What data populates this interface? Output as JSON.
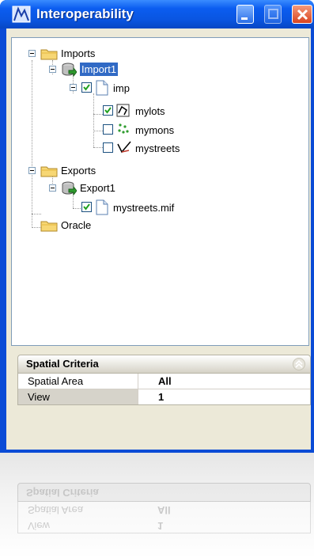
{
  "window": {
    "title": "Interoperability"
  },
  "tree": {
    "imports": "Imports",
    "import1": "Import1",
    "imp": "imp",
    "mylots": "mylots",
    "mymons": "mymons",
    "mystreets": "mystreets",
    "exports": "Exports",
    "export1": "Export1",
    "export_file": "mystreets.mif",
    "oracle": "Oracle"
  },
  "spatial_criteria": {
    "title": "Spatial Criteria",
    "rows": [
      {
        "label": "Spatial Area",
        "value": "All"
      },
      {
        "label": "View",
        "value": "1"
      }
    ]
  },
  "colors": {
    "titlebar": "#0a55e0",
    "selection": "#316ac5",
    "client": "#ece9d8"
  }
}
